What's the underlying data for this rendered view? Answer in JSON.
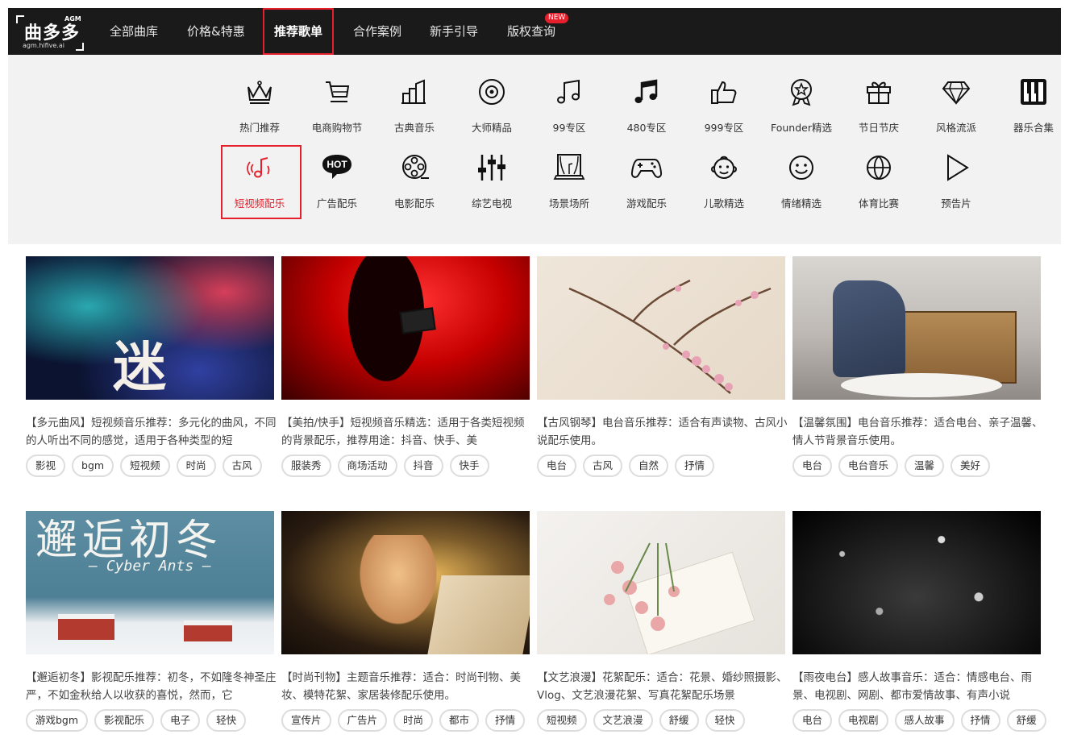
{
  "logo": {
    "name": "曲多多",
    "agm": "AGM",
    "url": "agm.hifive.ai"
  },
  "nav": {
    "items": [
      "全部曲库",
      "价格&特惠",
      "推荐歌单",
      "合作案例",
      "新手引导",
      "版权查询"
    ],
    "active": "推荐歌单",
    "badge": "NEW"
  },
  "categories": {
    "row1": [
      "热门推荐",
      "电商购物节",
      "古典音乐",
      "大师精品",
      "99专区",
      "480专区",
      "999专区",
      "Founder精选",
      "节日节庆",
      "风格流派",
      "器乐合集"
    ],
    "row2": [
      "短视频配乐",
      "广告配乐",
      "电影配乐",
      "综艺电视",
      "场景场所",
      "游戏配乐",
      "儿歌精选",
      "情绪精选",
      "体育比赛",
      "预告片"
    ],
    "row1_icons": [
      "crown-icon",
      "shopping-cart-icon",
      "building-bars-icon",
      "disc-icon",
      "music-note-outline-icon",
      "music-note-solid-icon",
      "thumbs-up-icon",
      "medal-icon",
      "gift-icon",
      "diamond-icon",
      "piano-keys-icon"
    ],
    "row2_icons": [
      "short-video-note-icon",
      "hot-badge-icon",
      "film-reel-icon",
      "equalizer-icon",
      "stage-icon",
      "gamepad-icon",
      "child-face-icon",
      "smiley-icon",
      "ball-icon",
      "play-triangle-icon"
    ],
    "hot_icon_text": "HOT",
    "active": "短视频配乐",
    "accent_color": "#e5202c"
  },
  "cards": [
    {
      "desc": "【多元曲风】短视频音乐推荐：多元化的曲风，不同的人听出不同的感觉，适用于各种类型的短",
      "tags": [
        "影视",
        "bgm",
        "短视频",
        "时尚",
        "古风"
      ],
      "art_text": "迷"
    },
    {
      "desc": "【美拍/快手】短视频音乐精选：适用于各类短视频的背景配乐，推荐用途：抖音、快手、美",
      "tags": [
        "服装秀",
        "商场活动",
        "抖音",
        "快手"
      ]
    },
    {
      "desc": "【古风钢琴】电台音乐推荐：适合有声读物、古风小说配乐使用。",
      "tags": [
        "电台",
        "古风",
        "自然",
        "抒情"
      ]
    },
    {
      "desc": "【温馨氛围】电台音乐推荐：适合电台、亲子温馨、情人节背景音乐使用。",
      "tags": [
        "电台",
        "电台音乐",
        "温馨",
        "美好"
      ]
    },
    {
      "desc": "【邂逅初冬】影视配乐推荐：初冬，不如隆冬神圣庄严，不如金秋给人以收获的喜悦，然而，它",
      "tags": [
        "游戏bgm",
        "影视配乐",
        "电子",
        "轻快"
      ],
      "art_text": "邂逅初冬",
      "art_sub": "— Cyber Ants —"
    },
    {
      "desc": "【时尚刊物】主题音乐推荐：适合：时尚刊物、美妆、模特花絮、家居装修配乐使用。",
      "tags": [
        "宣传片",
        "广告片",
        "时尚",
        "都市",
        "抒情"
      ]
    },
    {
      "desc": "【文艺浪漫】花絮配乐：适合：花景、婚纱照摄影、Vlog、文艺浪漫花絮、写真花絮配乐场景",
      "tags": [
        "短视频",
        "文艺浪漫",
        "舒缓",
        "轻快"
      ]
    },
    {
      "desc": "【雨夜电台】感人故事音乐：适合：情感电台、雨景、电视剧、网剧、都市爱情故事、有声小说",
      "tags": [
        "电台",
        "电视剧",
        "感人故事",
        "抒情",
        "舒缓"
      ]
    }
  ]
}
